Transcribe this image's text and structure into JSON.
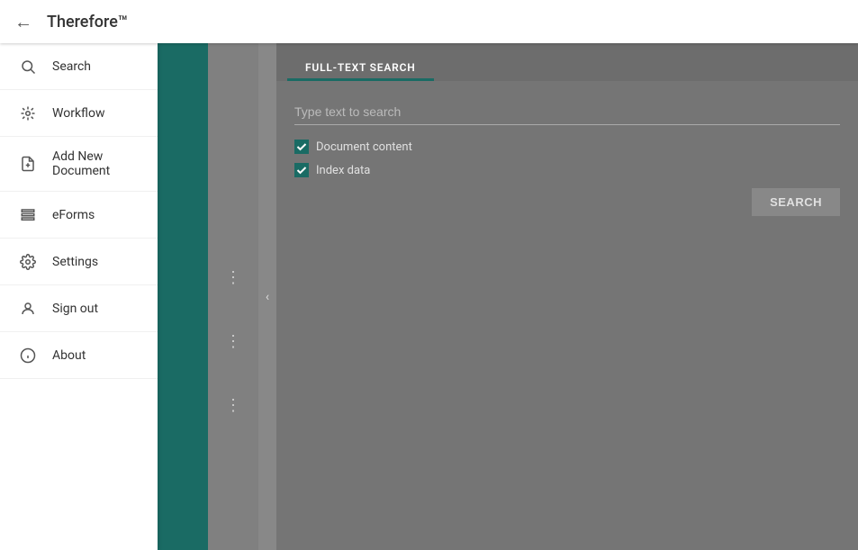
{
  "app": {
    "title": "Therefore™"
  },
  "sidebar": {
    "items": [
      {
        "id": "search",
        "label": "Search",
        "icon": "🔍"
      },
      {
        "id": "workflow",
        "label": "Workflow",
        "icon": "⚙"
      },
      {
        "id": "add-new-document",
        "label": "Add New Document",
        "icon": "📄"
      },
      {
        "id": "eforms",
        "label": "eForms",
        "icon": "☰"
      },
      {
        "id": "settings",
        "label": "Settings",
        "icon": "⚙"
      },
      {
        "id": "sign-out",
        "label": "Sign out",
        "icon": "👤"
      },
      {
        "id": "about",
        "label": "About",
        "icon": "❓"
      }
    ]
  },
  "tabs": [
    {
      "id": "full-text-search",
      "label": "FULL-TEXT SEARCH",
      "active": true
    }
  ],
  "search": {
    "placeholder": "Type text to search",
    "checkboxes": [
      {
        "id": "document-content",
        "label": "Document content",
        "checked": true
      },
      {
        "id": "index-data",
        "label": "Index data",
        "checked": true
      }
    ],
    "button_label": "SEARCH"
  },
  "back_icon": "←"
}
